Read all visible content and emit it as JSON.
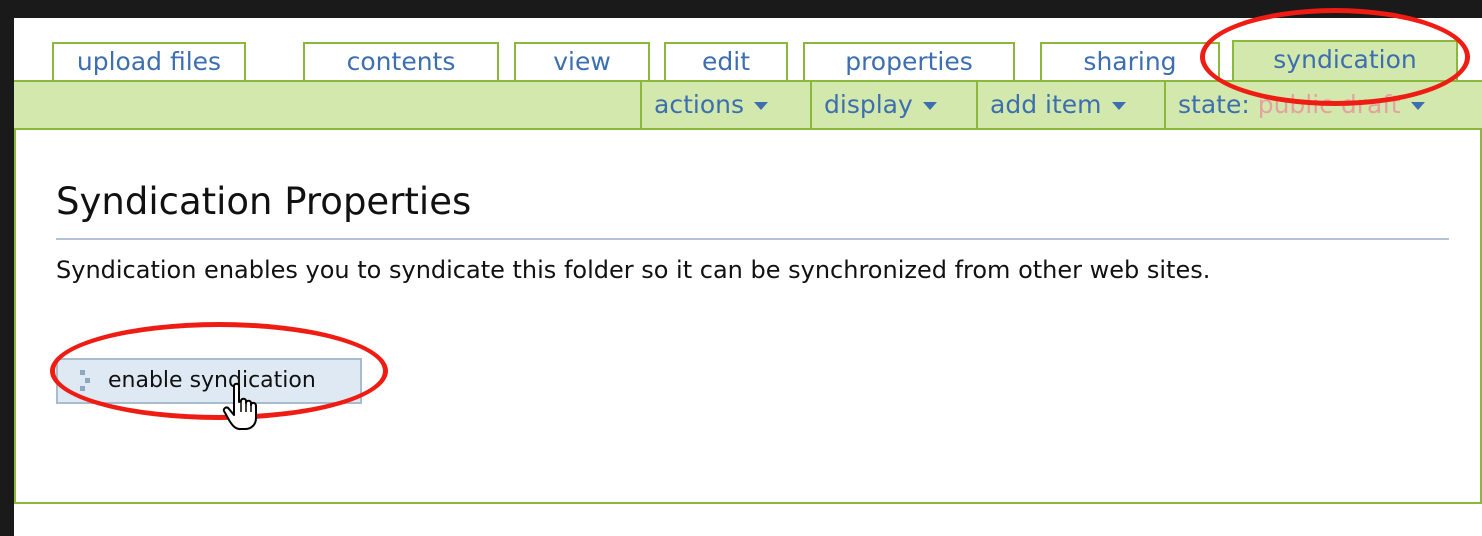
{
  "tabs": [
    {
      "label": "upload files"
    },
    {
      "label": "contents"
    },
    {
      "label": "view"
    },
    {
      "label": "edit"
    },
    {
      "label": "properties"
    },
    {
      "label": "sharing"
    },
    {
      "label": "syndication",
      "active": true
    }
  ],
  "actionbar": {
    "actions_label": "actions",
    "display_label": "display",
    "add_item_label": "add item",
    "state_label": "state:",
    "state_value": "public draft"
  },
  "main": {
    "title": "Syndication Properties",
    "description": "Syndication enables you to syndicate this folder so it can be synchronized from other web sites.",
    "enable_button_label": "enable syndication"
  },
  "colors": {
    "accent_green": "#8bb83a",
    "bar_green": "#d3e8ad",
    "link_blue": "#3d6fb0",
    "annotation_red": "#ee1c12",
    "state_pink": "#e3a3a0"
  },
  "icons": [
    "caret-down-icon",
    "button-dots-icon",
    "hand-pointer-cursor-icon"
  ]
}
